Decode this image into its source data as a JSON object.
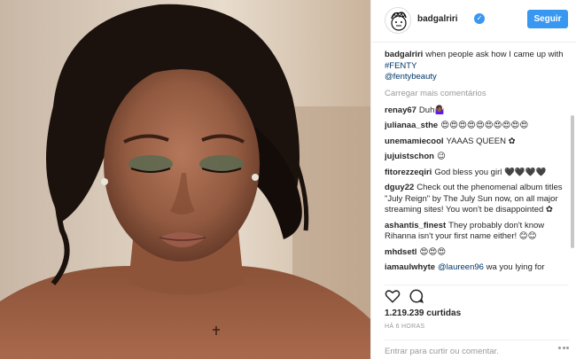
{
  "header": {
    "username": "badgalriri",
    "verified_icon": "verified-badge-icon",
    "follow_label": "Seguir"
  },
  "caption": {
    "username": "badgalriri",
    "text": "when people ask how I came up with ",
    "hashtag": "#FENTY",
    "mention": "@fentybeauty"
  },
  "load_more": "Carregar mais comentários",
  "comments": [
    {
      "user": "renay67",
      "text": "Duh🤷🏾‍♀️"
    },
    {
      "user": "julianaa_sthe",
      "text": "😍😍😍😍😍😍😍😍😍😍"
    },
    {
      "user": "unemamiecool",
      "text": "YAAAS QUEEN ✿"
    },
    {
      "user": "jujuistschon",
      "text": "😉"
    },
    {
      "user": "fitorezzeqiri",
      "text": "God bless you girl 🖤🖤🖤🖤"
    },
    {
      "user": "dguy22",
      "text": "Check out the phenomenal album titles \"July Reign\" by The July Sun now, on all major streaming sites! You won't be disappointed ✿"
    },
    {
      "user": "ashantis_finest",
      "text": "They probably don't know Rihanna isn't your first name either! 😊😊"
    },
    {
      "user": "mhdsetl",
      "text": "😍😍😍"
    },
    {
      "user": "iamaulwhyte",
      "text_prefix": "",
      "mention": "@laureen96",
      "text": "  wa you lying for"
    }
  ],
  "likes": "1.219.239 curtidas",
  "time": "HÁ 6 HORAS",
  "comment_input": {
    "placeholder": "Entrar para curtir ou comentar."
  },
  "icons": {
    "like": "heart-icon",
    "comment": "comment-icon",
    "more": "more-options-icon"
  },
  "colors": {
    "accent": "#3897f0",
    "link": "#003569",
    "muted": "#999999"
  }
}
